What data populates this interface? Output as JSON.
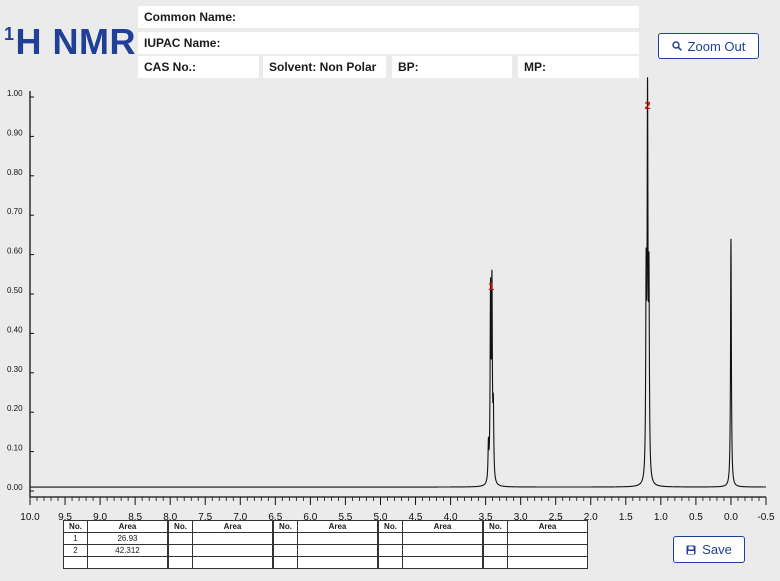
{
  "header": {
    "title_sup": "1",
    "title_main": "H NMR",
    "common_name_label": "Common Name:",
    "iupac_name_label": "IUPAC Name:",
    "cas_label": "CAS No.:",
    "solvent_label": "Solvent: Non Polar",
    "bp_label": "BP:",
    "mp_label": "MP:"
  },
  "buttons": {
    "zoom_out": "Zoom Out",
    "save": "Save"
  },
  "peak_tables": [
    {
      "header_no": "No.",
      "header_area": "Area",
      "rows": [
        {
          "no": "1",
          "area": "26.93"
        },
        {
          "no": "2",
          "area": "42.312"
        },
        {
          "no": "",
          "area": ""
        }
      ]
    },
    {
      "header_no": "No.",
      "header_area": "Area",
      "rows": [
        {
          "no": "",
          "area": ""
        },
        {
          "no": "",
          "area": ""
        },
        {
          "no": "",
          "area": ""
        }
      ]
    },
    {
      "header_no": "No.",
      "header_area": "Area",
      "rows": [
        {
          "no": "",
          "area": ""
        },
        {
          "no": "",
          "area": ""
        },
        {
          "no": "",
          "area": ""
        }
      ]
    },
    {
      "header_no": "No.",
      "header_area": "Area",
      "rows": [
        {
          "no": "",
          "area": ""
        },
        {
          "no": "",
          "area": ""
        },
        {
          "no": "",
          "area": ""
        }
      ]
    },
    {
      "header_no": "No.",
      "header_area": "Area",
      "rows": [
        {
          "no": "",
          "area": ""
        },
        {
          "no": "",
          "area": ""
        },
        {
          "no": "",
          "area": ""
        }
      ]
    }
  ],
  "chart_data": {
    "type": "line",
    "xlabel": "",
    "ylabel": "",
    "xlim": [
      10.0,
      -0.5
    ],
    "ylim": [
      0.0,
      1.0
    ],
    "x_reversed": true,
    "x_ticks": [
      "10.0",
      "9.5",
      "9.0",
      "8.5",
      "8.0",
      "7.5",
      "7.0",
      "6.5",
      "6.0",
      "5.5",
      "5.0",
      "4.5",
      "4.0",
      "3.5",
      "3.0",
      "2.5",
      "2.0",
      "1.5",
      "1.0",
      "0.5",
      "0.0",
      "-0.5"
    ],
    "y_ticks": [
      "0.00",
      "0.10",
      "0.20",
      "0.30",
      "0.40",
      "0.50",
      "0.60",
      "0.70",
      "0.80",
      "0.90",
      "1.00"
    ],
    "baseline": 0.01,
    "grid": false,
    "peaks": [
      {
        "ppm": 3.46,
        "intensity": 0.1
      },
      {
        "ppm": 3.43,
        "intensity": 0.48
      },
      {
        "ppm": 3.41,
        "intensity": 0.49
      },
      {
        "ppm": 3.39,
        "intensity": 0.18
      },
      {
        "ppm": 1.21,
        "intensity": 0.5
      },
      {
        "ppm": 1.19,
        "intensity": 0.95
      },
      {
        "ppm": 1.17,
        "intensity": 0.49
      },
      {
        "ppm": 0.0,
        "intensity": 0.64
      }
    ],
    "peak_labels": [
      {
        "label": "1",
        "ppm": 3.42,
        "intensity": 0.5
      },
      {
        "label": "2",
        "ppm": 1.19,
        "intensity": 0.96
      }
    ],
    "label_color": "#cc1111",
    "line_color": "#111111"
  }
}
